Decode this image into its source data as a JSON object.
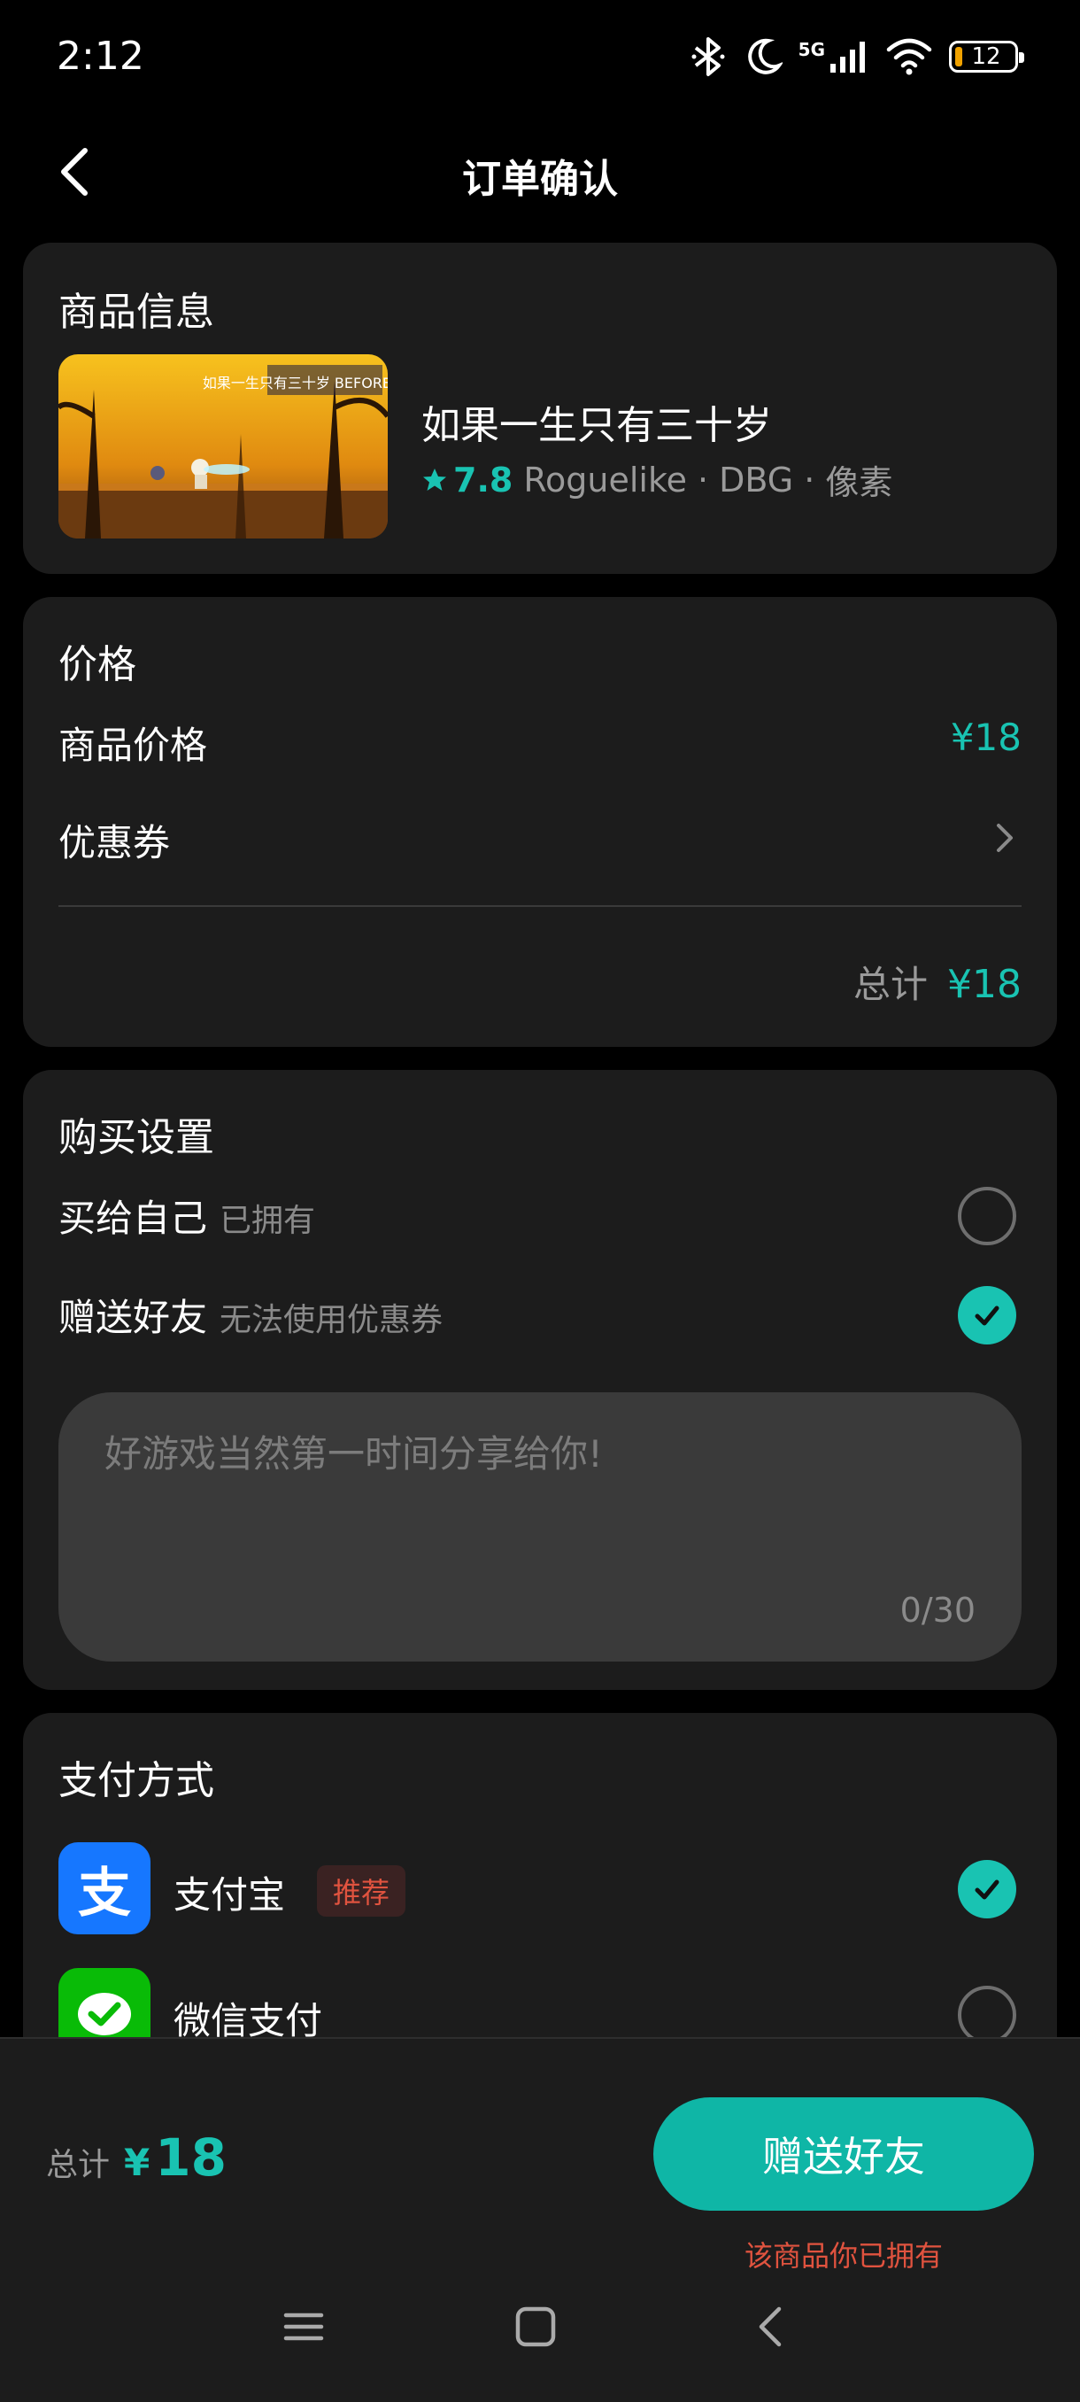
{
  "status_bar": {
    "time": "2:12",
    "network": "5G",
    "battery": "12"
  },
  "header": {
    "title": "订单确认"
  },
  "product": {
    "section_title": "商品信息",
    "name": "如果一生只有三十岁",
    "rating": "7.8",
    "tags": [
      "Roguelike",
      "DBG",
      "像素"
    ],
    "tag_separator": "·",
    "thumbnail_caption": "如果一生只有三十岁 BEFORE THIRTY"
  },
  "price": {
    "section_title": "价格",
    "item_label": "商品价格",
    "item_value": "¥18",
    "coupon_label": "优惠券",
    "total_label": "总计",
    "total_value": "¥18"
  },
  "purchase": {
    "section_title": "购买设置",
    "self_label": "买给自己",
    "self_note": "已拥有",
    "gift_label": "赠送好友",
    "gift_note": "无法使用优惠券",
    "message_placeholder": "好游戏当然第一时间分享给你!",
    "message_count": "0/30"
  },
  "payment": {
    "section_title": "支付方式",
    "alipay_label": "支付宝",
    "alipay_glyph": "支",
    "alipay_tag": "推荐",
    "wechat_label": "微信支付"
  },
  "bottom": {
    "total_label": "总计",
    "currency": "¥",
    "total_amount": "18",
    "cta_label": "赠送好友",
    "cta_note": "该商品你已拥有"
  },
  "colors": {
    "accent": "#19c3b2",
    "warning": "#e0533f",
    "card": "#1c1c1c",
    "alipay": "#1677ff",
    "wechat": "#09bb07"
  }
}
